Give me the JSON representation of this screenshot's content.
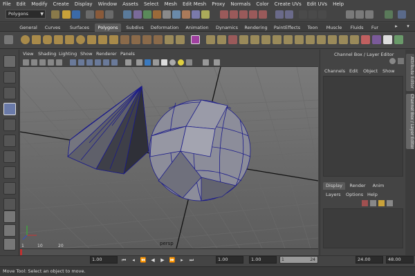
{
  "menubar": {
    "items": [
      "File",
      "Edit",
      "Modify",
      "Create",
      "Display",
      "Window",
      "Assets",
      "Select",
      "Mesh",
      "Edit Mesh",
      "Proxy",
      "Normals",
      "Color",
      "Create UVs",
      "Edit UVs",
      "Help"
    ]
  },
  "status_line": {
    "mode_select": "Polygons"
  },
  "shelf": {
    "tabs": [
      "General",
      "Curves",
      "Surfaces",
      "Polygons",
      "Subdivs",
      "Deformation",
      "Animation",
      "Dynamics",
      "Rendering",
      "PaintEffects",
      "Toon",
      "Muscle",
      "Fluids",
      "Fur"
    ],
    "active_tab": "Polygons"
  },
  "panel": {
    "menus": [
      "View",
      "Shading",
      "Lighting",
      "Show",
      "Renderer",
      "Panels"
    ],
    "camera_label": "persp"
  },
  "channel_box": {
    "title": "Channel Box / Layer Editor",
    "menus": [
      "Channels",
      "Edit",
      "Object",
      "Show"
    ]
  },
  "layer_editor": {
    "tabs": [
      "Display",
      "Render",
      "Anim"
    ],
    "active_tab": "Display",
    "menus": [
      "Layers",
      "Options",
      "Help"
    ]
  },
  "side_tabs": [
    "Attribute Editor",
    "Channel Box / Layer Editor"
  ],
  "time_slider": {
    "ticks": [
      "1",
      "10",
      "20",
      "24"
    ]
  },
  "range": {
    "current_time": "1.00",
    "start": "1.00",
    "range_start": "1.00",
    "range_slider_start": "1",
    "range_slider_end": "24",
    "range_end": "24.00",
    "end": "48.00"
  },
  "help_line": "Move Tool: Select an object to move.",
  "colors": {
    "ui_background": "#444444",
    "viewport_top": "#7a7a7a",
    "viewport_bottom": "#5c5c5c",
    "grid": "#6a6a6a",
    "mesh_face": "#8c8d9a",
    "wire": "#1a1a8a",
    "active_tab": "#5a5a5a"
  }
}
